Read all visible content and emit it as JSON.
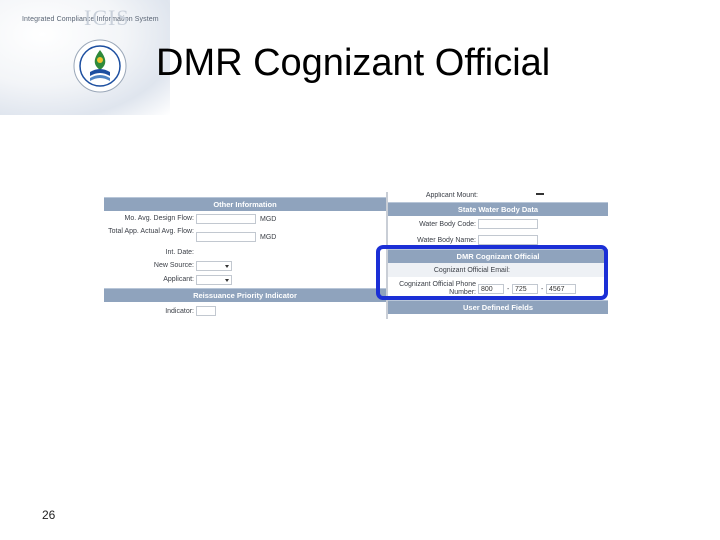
{
  "header": {
    "brand_line": "Integrated Compliance Information System",
    "brand_acronym": "ICIS",
    "slide_title": "DMR Cognizant Official",
    "page_number": "26"
  },
  "left_panel": {
    "other_info_title": "Other Information",
    "fields": [
      {
        "label": "Mo. Avg. Design Flow:",
        "unit": "MGD"
      },
      {
        "label": "Total App. Actual Avg. Flow:",
        "unit": "MGD"
      },
      {
        "label": "Int. Date:"
      },
      {
        "label": "New Source:"
      },
      {
        "label": "Applicant:"
      }
    ],
    "reissuance_title": "Reissuance Priority Indicator",
    "indicator_label": "Indicator:"
  },
  "right_panel": {
    "top_label": "Applicant Mount:",
    "state_water_title": "State Water Body Data",
    "water_body_code_label": "Water Body Code:",
    "water_body_name_label": "Water Body Name:",
    "dmr_title": "DMR Cognizant Official",
    "cognizant_email_label": "Cognizant Official Email:",
    "cognizant_phone_label": "Cognizant Official Phone Number:",
    "phone": {
      "area": "800",
      "prefix": "725",
      "line": "4567"
    },
    "user_defined_title": "User Defined Fields"
  },
  "colors": {
    "section_header": "#8fa3bd",
    "highlight_border": "#1b2fd6"
  }
}
